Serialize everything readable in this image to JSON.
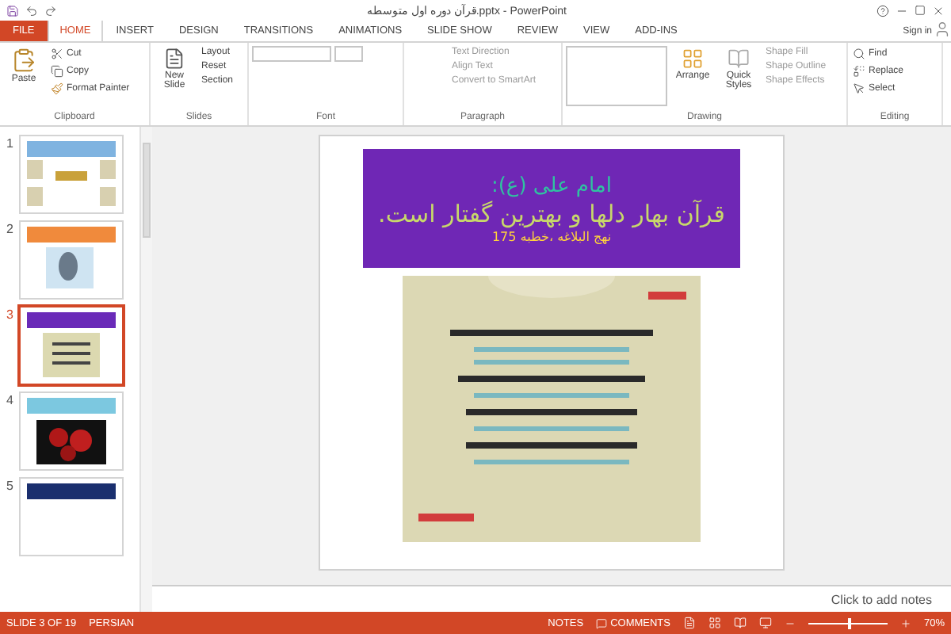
{
  "window": {
    "title": "قرآن دوره اول متوسطه.pptx - PowerPoint",
    "sign_in": "Sign in"
  },
  "tabs": [
    {
      "label": "FILE",
      "kind": "file",
      "selected": false
    },
    {
      "label": "HOME",
      "kind": "tab",
      "selected": true
    },
    {
      "label": "INSERT",
      "kind": "tab",
      "selected": false
    },
    {
      "label": "DESIGN",
      "kind": "tab",
      "selected": false
    },
    {
      "label": "TRANSITIONS",
      "kind": "tab",
      "selected": false
    },
    {
      "label": "ANIMATIONS",
      "kind": "tab",
      "selected": false
    },
    {
      "label": "SLIDE SHOW",
      "kind": "tab",
      "selected": false
    },
    {
      "label": "REVIEW",
      "kind": "tab",
      "selected": false
    },
    {
      "label": "VIEW",
      "kind": "tab",
      "selected": false
    },
    {
      "label": "ADD-INS",
      "kind": "tab",
      "selected": false
    }
  ],
  "ribbon": {
    "clipboard": {
      "label": "Clipboard",
      "paste": "Paste",
      "cut": "Cut",
      "copy": "Copy",
      "format_painter": "Format Painter"
    },
    "slides": {
      "label": "Slides",
      "new_slide": "New Slide",
      "layout": "Layout",
      "reset": "Reset",
      "section": "Section"
    },
    "font": {
      "label": "Font"
    },
    "paragraph": {
      "label": "Paragraph",
      "text_direction": "Text Direction",
      "align_text": "Align Text",
      "convert": "Convert to SmartArt"
    },
    "drawing": {
      "label": "Drawing",
      "arrange": "Arrange",
      "quick_styles": "Quick Styles",
      "shape_fill": "Shape Fill",
      "shape_outline": "Shape Outline",
      "shape_effects": "Shape Effects"
    },
    "editing": {
      "label": "Editing",
      "find": "Find",
      "replace": "Replace",
      "select": "Select"
    }
  },
  "slides": [
    {
      "number": "1",
      "selected": false,
      "color": "#7fb3e0"
    },
    {
      "number": "2",
      "selected": false,
      "color": "#f08a3c"
    },
    {
      "number": "3",
      "selected": true,
      "color": "#6a2ab8"
    },
    {
      "number": "4",
      "selected": false,
      "color": "#7cc8e0"
    },
    {
      "number": "5",
      "selected": false,
      "color": "#1a2f6e"
    }
  ],
  "slide": {
    "heading": "امام علی (ع):",
    "headline": "قرآن بهار دلها و بهترین گفتار است.",
    "source": "نهج البلاغه ،خطبه 175"
  },
  "notes": {
    "placeholder": "Click to add notes"
  },
  "status_bar": {
    "slide": "SLIDE 3 OF 19",
    "language": "PERSIAN",
    "notes": "NOTES",
    "comments": "COMMENTS",
    "zoom": "70%",
    "zoom_level": {
      "level": 0.5
    }
  }
}
